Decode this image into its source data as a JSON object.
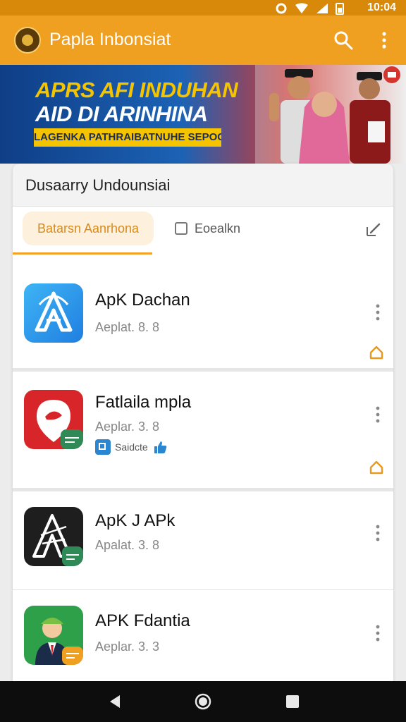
{
  "status": {
    "time": "10:04"
  },
  "appbar": {
    "title": "Papla Inbonsiat"
  },
  "banner": {
    "line1": "APRS AFI INDUHAN",
    "line2": "AID DI ARINHINA",
    "strip": "LAGENKA PATHRAIBATNUHE SEPOCANS"
  },
  "sheet": {
    "title": "Dusaarry Undounsiai"
  },
  "tabs": {
    "active": "Batarsn Aanrhona",
    "second": "Eoealkn"
  },
  "apps": [
    {
      "name": "ApK Dachan",
      "version": "Aeplat. 8. 8"
    },
    {
      "name": "Fatlaila mpla",
      "version": "Aeplar. 3. 8",
      "rating_label": "Saidcte"
    },
    {
      "name": "ApK J APk",
      "version": "Apalat. 3. 8"
    },
    {
      "name": "APK Fdantia",
      "version": "Aeplar. 3. 3"
    }
  ],
  "colors": {
    "accent": "#f0a020",
    "statusbar": "#d9890a",
    "tab_text": "#d88b1a"
  }
}
